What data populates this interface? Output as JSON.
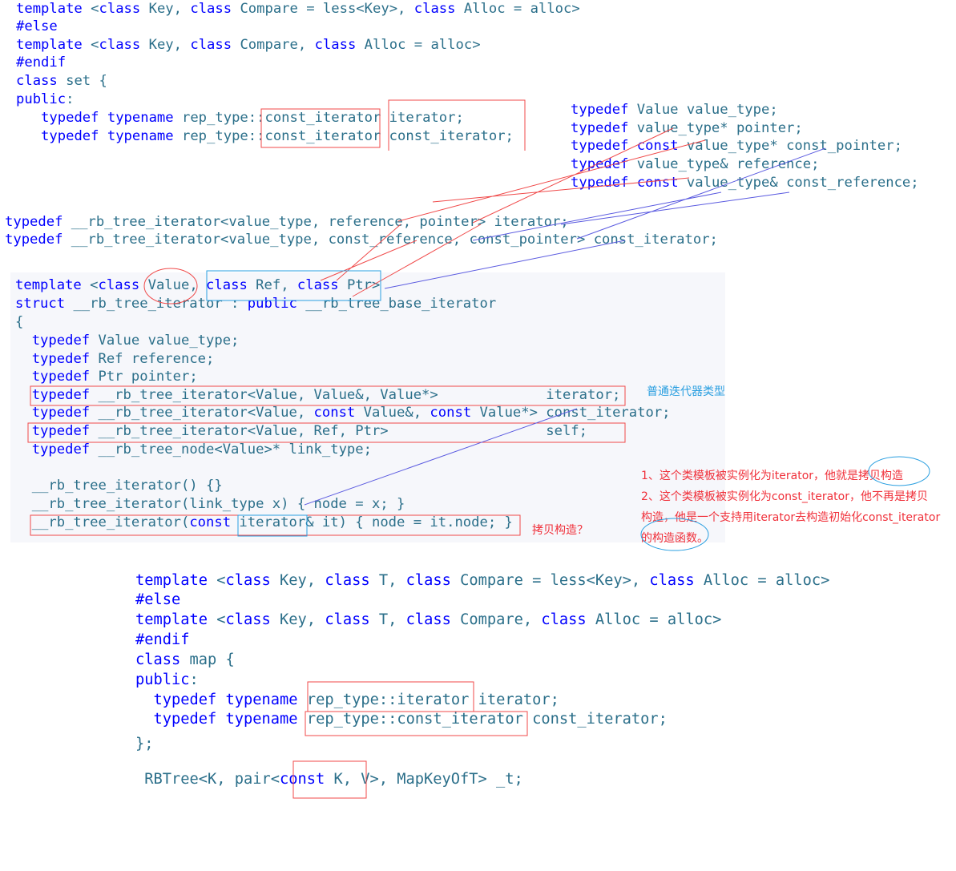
{
  "set_block": [
    "template <class Key, class Compare = less<Key>, class Alloc = alloc>",
    "#else",
    "template <class Key, class Compare, class Alloc = alloc>",
    "#endif",
    "class set {",
    "public:",
    "   typedef typename rep_type::const_iterator iterator;",
    "   typedef typename rep_type::const_iterator const_iterator;"
  ],
  "value_typedefs": [
    "typedef Value value_type;",
    "typedef value_type* pointer;",
    "typedef const value_type* const_pointer;",
    "typedef value_type& reference;",
    "typedef const value_type& const_reference;"
  ],
  "rb_tree_typedefs": [
    "typedef __rb_tree_iterator<value_type, reference, pointer> iterator;",
    "typedef __rb_tree_iterator<value_type, const_reference, const_pointer> const_iterator;"
  ],
  "iterator_block": [
    "template <class Value, class Ref, class Ptr>",
    "struct __rb_tree_iterator : public __rb_tree_base_iterator",
    "{",
    "  typedef Value value_type;",
    "  typedef Ref reference;",
    "  typedef Ptr pointer;",
    "  typedef __rb_tree_iterator<Value, Value&, Value*>             iterator;",
    "  typedef __rb_tree_iterator<Value, const Value&, const Value*> const_iterator;",
    "  typedef __rb_tree_iterator<Value, Ref, Ptr>                   self;",
    "  typedef __rb_tree_node<Value>* link_type;",
    "",
    "  __rb_tree_iterator() {}",
    "  __rb_tree_iterator(link_type x) { node = x; }",
    "  __rb_tree_iterator(const iterator& it) { node = it.node; }"
  ],
  "map_block": [
    "template <class Key, class T, class Compare = less<Key>, class Alloc = alloc>",
    "#else",
    "template <class Key, class T, class Compare, class Alloc = alloc>",
    "#endif",
    "class map {",
    "public:",
    "  typedef typename rep_type::iterator iterator;",
    "  typedef typename rep_type::const_iterator const_iterator;",
    "};",
    " RBTree<K, pair<const K, V>, MapKeyOfT> _t;"
  ],
  "annotations": {
    "normal_iterator_type": "普通迭代器类型",
    "copy_ctor_question": "拷贝构造？",
    "note_lines": [
      "1、这个类模板被实例化为iterator，他就是拷贝构造",
      "2、这个类模板被实例化为const_iterator，他不再是拷贝",
      "构造，他是一个支持用iterator去构造初始化const_iterator",
      "的构造函数。"
    ]
  },
  "colors": {
    "keyword": "#0000ff",
    "identifier": "#2b6f8a",
    "annotation_red": "#f0303a",
    "annotation_blue": "#2a9fe0"
  }
}
